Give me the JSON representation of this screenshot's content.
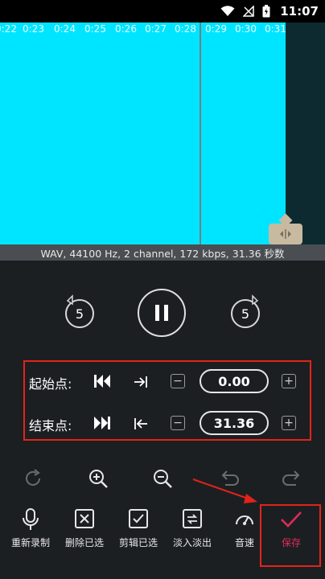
{
  "status_bar": {
    "time": "11:07"
  },
  "waveform": {
    "time_ticks": [
      "0:22",
      "0:23",
      "0:24",
      "0:25",
      "0:26",
      "0:27",
      "0:28",
      "0:29",
      "0:30",
      "0:31"
    ],
    "selection_color": "#00e5ff"
  },
  "info_bar": {
    "text": "WAV, 44100 Hz, 2 channel, 172 kbps, 31.36 秒数"
  },
  "playback": {
    "rewind_label": "5",
    "forward_label": "5"
  },
  "range": {
    "start_label": "起始点:",
    "start_value": "0.00",
    "end_label": "结束点:",
    "end_value": "31.36"
  },
  "bottom_actions": {
    "re_record": "重新录制",
    "delete_selected": "删除已选",
    "trim_selected": "剪辑已选",
    "fade": "淡入淡出",
    "volume": "音速",
    "save": "保存"
  },
  "colors": {
    "accent": "#e02b59",
    "highlight": "#e3231a"
  }
}
